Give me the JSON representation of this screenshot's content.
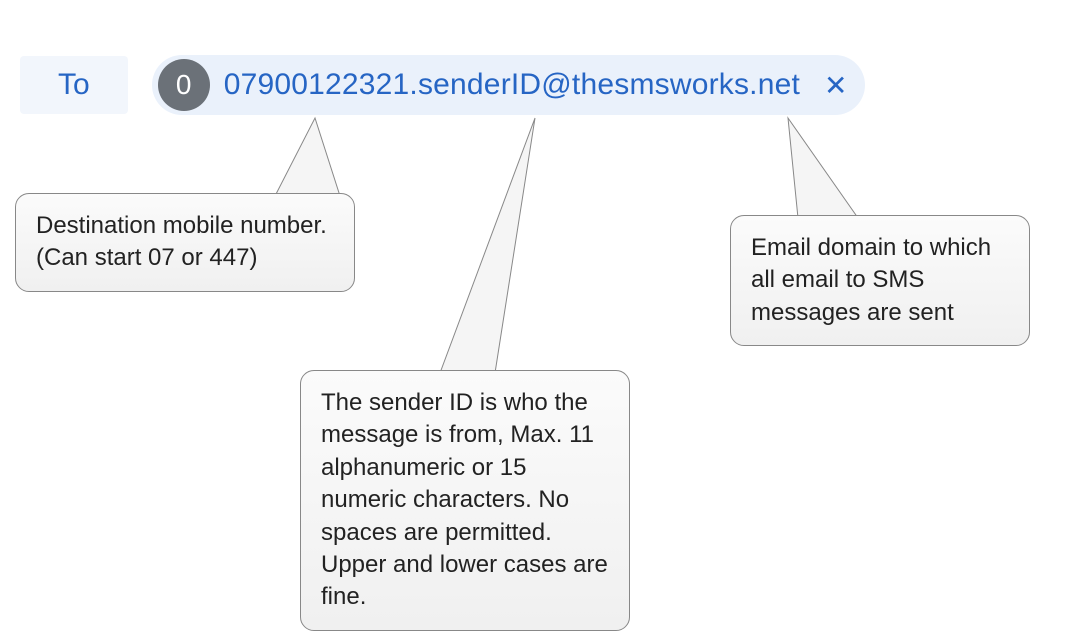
{
  "email_field": {
    "label": "To",
    "avatar_initial": "0",
    "address": "07900122321.senderID@thesmsworks.net",
    "close_glyph": "✕"
  },
  "callouts": {
    "destination": "Destination mobile number.\n(Can start 07 or 447)",
    "sender_id": "The sender ID is who the message is from, Max. 11 alphanumeric or 15 numeric characters. No spaces are permitted. Upper and lower cases are fine.",
    "domain": "Email domain to which all email to SMS messages are sent"
  }
}
